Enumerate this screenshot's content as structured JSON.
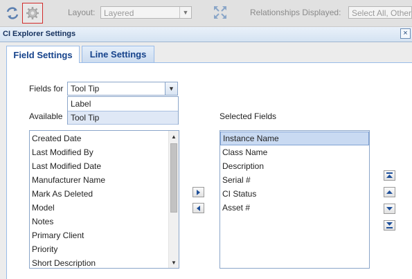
{
  "toolbar": {
    "layout_label": "Layout:",
    "layout_value": "Layered",
    "relationships_label": "Relationships Displayed:",
    "relationships_value": "Select All, Other,"
  },
  "dialog": {
    "title": "CI Explorer Settings",
    "close_symbol": "×"
  },
  "tabs": [
    {
      "label": "Field Settings",
      "active": true
    },
    {
      "label": "Line Settings",
      "active": false
    }
  ],
  "fields_for": {
    "label": "Fields for",
    "value": "Tool Tip",
    "options": [
      {
        "label": "Label",
        "selected": false
      },
      {
        "label": "Tool Tip",
        "selected": true
      }
    ]
  },
  "available": {
    "label": "Available",
    "items": [
      "Created Date",
      "Last Modified By",
      "Last Modified Date",
      "Manufacturer Name",
      "Mark As Deleted",
      "Model",
      "Notes",
      "Primary Client",
      "Priority",
      "Short Description"
    ]
  },
  "selected": {
    "label": "Selected Fields",
    "items": [
      "Instance Name",
      "Class Name",
      "Description",
      "Serial #",
      "CI Status",
      "Asset #"
    ],
    "selected_index": 0
  },
  "icons": {
    "refresh": "refresh-icon",
    "settings": "gear-icon",
    "expand": "expand-icon",
    "move_right": "arrow-right-icon",
    "move_left": "arrow-left-icon",
    "move_top": "move-top-icon",
    "move_up": "move-up-icon",
    "move_down": "move-down-icon",
    "move_bottom": "move-bottom-icon"
  },
  "colors": {
    "tab_text": "#15428b",
    "dialog_title": "#15315e",
    "selected_row": "#c9daf2",
    "gear_border": "#d12a2a"
  }
}
